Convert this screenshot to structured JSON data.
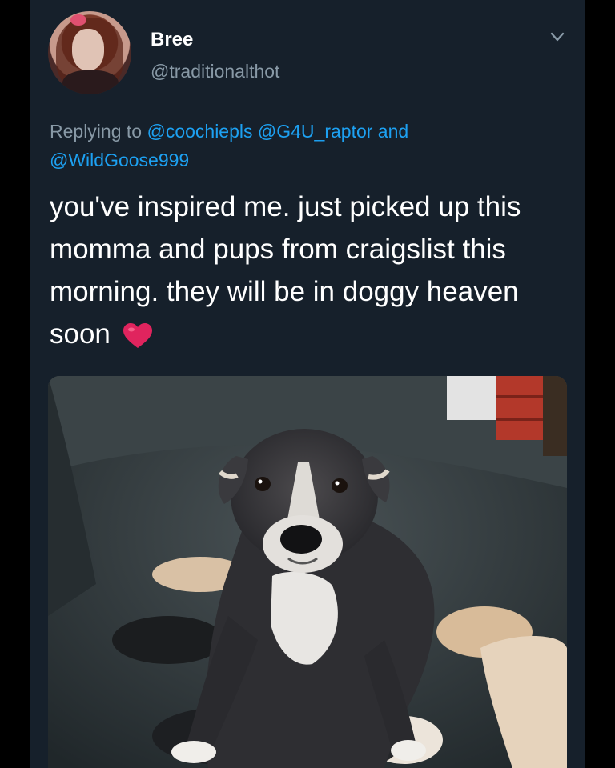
{
  "tweet": {
    "display_name": "Bree",
    "handle": "@traditionalthot",
    "reply_prefix": "Replying to",
    "reply_mentions": [
      "@coochiepls",
      "@G4U_raptor"
    ],
    "reply_and": "and",
    "reply_last": "@WildGoose999",
    "text": "you've inspired me. just picked up this momma and pups from craigslist this morning. they will be in doggy heaven soon",
    "emoji": "heart-emoji",
    "menu_icon": "chevron-down-icon",
    "photo_icon": "photo-dog-with-puppies"
  },
  "colors": {
    "background": "#16202b",
    "link": "#1da1f2",
    "muted": "#8899a6",
    "heart": "#e0245e"
  }
}
